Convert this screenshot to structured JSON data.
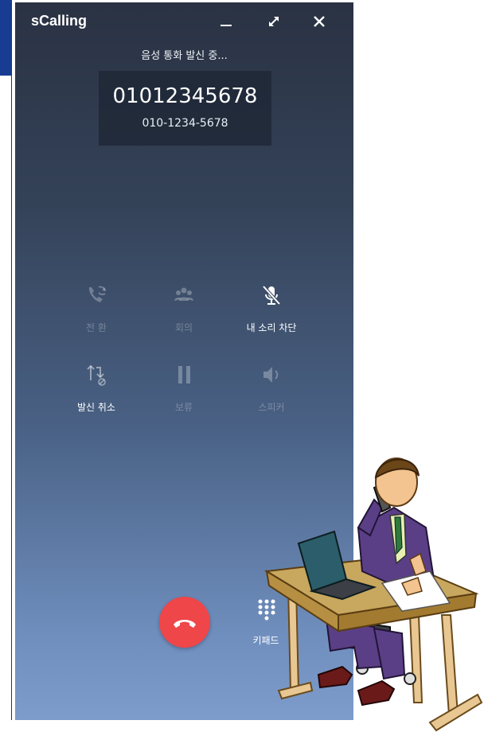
{
  "window": {
    "title": "sCalling",
    "minimize_icon": "minimize-icon",
    "maximize_icon": "expand-icon",
    "close_icon": "close-icon"
  },
  "call": {
    "status": "음성 통화 발신 중...",
    "number": "01012345678",
    "number_formatted": "010-1234-5678"
  },
  "controls": [
    {
      "label": "전 환",
      "icon": "call-transfer-icon",
      "enabled": false
    },
    {
      "label": "회의",
      "icon": "conference-icon",
      "enabled": false
    },
    {
      "label": "내 소리 차단",
      "icon": "mute-mic-icon",
      "enabled": true
    },
    {
      "label": "발신 취소",
      "icon": "cancel-call-icon",
      "enabled": true
    },
    {
      "label": "보류",
      "icon": "pause-icon",
      "enabled": false
    },
    {
      "label": "스피커",
      "icon": "speaker-icon",
      "enabled": false
    }
  ],
  "bottom": {
    "hangup_icon": "hang-up-icon",
    "keypad_label": "키패드",
    "keypad_icon": "keypad-icon"
  },
  "colors": {
    "hangup": "#ee4649",
    "gradient_top": "#2a3243",
    "gradient_bottom": "#7d9ccb"
  }
}
